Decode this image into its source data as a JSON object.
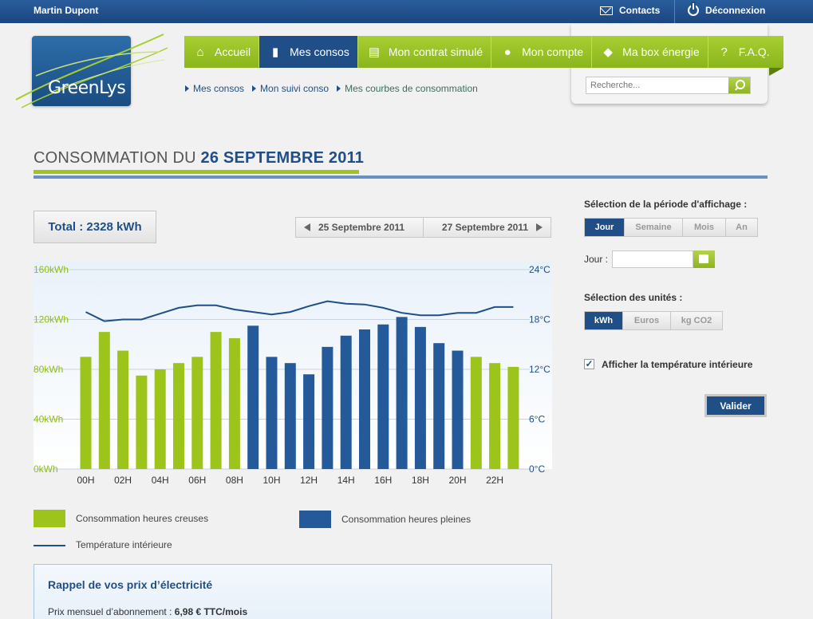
{
  "topbar": {
    "user": "Martin Dupont",
    "contacts": "Contacts",
    "logout": "Déconnexion"
  },
  "logo": {
    "name": "GreenLys"
  },
  "nav": {
    "items": [
      {
        "label": "Accueil",
        "icon": "home-icon",
        "active": false
      },
      {
        "label": "Mes consos",
        "icon": "bar-chart-icon",
        "active": true
      },
      {
        "label": "Mon contrat simulé",
        "icon": "document-icon",
        "active": false
      },
      {
        "label": "Mon compte",
        "icon": "user-icon",
        "active": false
      },
      {
        "label": "Ma box énergie",
        "icon": "box-icon",
        "active": false
      },
      {
        "label": "F.A.Q.",
        "icon": "question-icon",
        "active": false
      }
    ]
  },
  "search": {
    "placeholder": "Recherche..."
  },
  "breadcrumb": [
    "Mes consos",
    "Mon suivi conso",
    "Mes courbes de consommation"
  ],
  "title": {
    "prefix": "CONSOMMATION DU ",
    "date": "26 SEPTEMBRE 2011"
  },
  "total": "Total : 2328 kWh",
  "date_nav": {
    "prev": "25 Septembre 2011",
    "next": "27 Septembre 2011"
  },
  "colors": {
    "off_peak": "#9dc41a",
    "peak": "#245a9a",
    "temperature": "#1f4f86",
    "accent_green": "#9dc423",
    "brand_blue": "#1f4f86"
  },
  "chart_data": {
    "type": "bar",
    "categories": [
      "00H",
      "01H",
      "02H",
      "03H",
      "04H",
      "05H",
      "06H",
      "07H",
      "08H",
      "09H",
      "10H",
      "11H",
      "12H",
      "13H",
      "14H",
      "15H",
      "16H",
      "17H",
      "18H",
      "19H",
      "20H",
      "21H",
      "22H",
      "23H"
    ],
    "x_tick_labels": [
      "00H",
      "02H",
      "04H",
      "06H",
      "08H",
      "10H",
      "12H",
      "14H",
      "16H",
      "18H",
      "20H",
      "22H"
    ],
    "series": [
      {
        "name": "Consommation heures creuses",
        "kind": "bar",
        "axis": "left",
        "values": [
          90,
          110,
          95,
          75,
          80,
          85,
          90,
          110,
          105,
          null,
          null,
          null,
          null,
          null,
          null,
          null,
          null,
          null,
          null,
          null,
          null,
          90,
          85,
          82
        ]
      },
      {
        "name": "Consommation heures pleines",
        "kind": "bar",
        "axis": "left",
        "values": [
          null,
          null,
          null,
          null,
          null,
          null,
          null,
          null,
          null,
          115,
          90,
          85,
          76,
          98,
          107,
          112,
          116,
          122,
          114,
          101,
          95,
          null,
          null,
          null
        ]
      },
      {
        "name": "Température intérieure",
        "kind": "line",
        "axis": "right",
        "values": [
          18.9,
          17.8,
          18.0,
          18.0,
          18.7,
          19.4,
          19.7,
          19.7,
          19.2,
          18.9,
          18.6,
          18.9,
          19.6,
          20.2,
          19.9,
          19.8,
          19.4,
          18.8,
          18.5,
          18.5,
          18.8,
          18.8,
          19.5,
          19.5
        ]
      }
    ],
    "y_left": {
      "ylim": [
        0,
        160
      ],
      "ticks": [
        "0kWh",
        "40kWh",
        "80kWh",
        "120kWh",
        "160kWh"
      ]
    },
    "y_right": {
      "ylim": [
        0,
        24
      ],
      "ticks": [
        "0°C",
        "6°C",
        "12°C",
        "18°C",
        "24°C"
      ]
    },
    "grid": true,
    "legend": [
      {
        "label": "Consommation heures creuses",
        "kind": "swatch",
        "color": "#9dc41a"
      },
      {
        "label": "Consommation heures pleines",
        "kind": "swatch",
        "color": "#245a9a"
      },
      {
        "label": "Température intérieure",
        "kind": "line",
        "color": "#1f4f86"
      }
    ]
  },
  "prices": {
    "heading": "Rappel de vos prix d’électricité",
    "subscription_label": "Prix mensuel d’abonnement : ",
    "subscription_value": "6,98 € TTC/mois"
  },
  "side": {
    "period_label": "Sélection de la période d'affichage :",
    "period_options": [
      {
        "label": "Jour",
        "on": true
      },
      {
        "label": "Semaine",
        "on": false
      },
      {
        "label": "Mois",
        "on": false
      },
      {
        "label": "An",
        "on": false
      }
    ],
    "day_label": "Jour :",
    "day_value": "",
    "units_label": "Sélection des unités :",
    "unit_options": [
      {
        "label": "kWh",
        "on": true
      },
      {
        "label": "Euros",
        "on": false
      },
      {
        "label": "kg CO2",
        "on": false
      }
    ],
    "show_temp_label": "Afficher la température intérieure",
    "show_temp_checked": true,
    "submit": "Valider"
  }
}
